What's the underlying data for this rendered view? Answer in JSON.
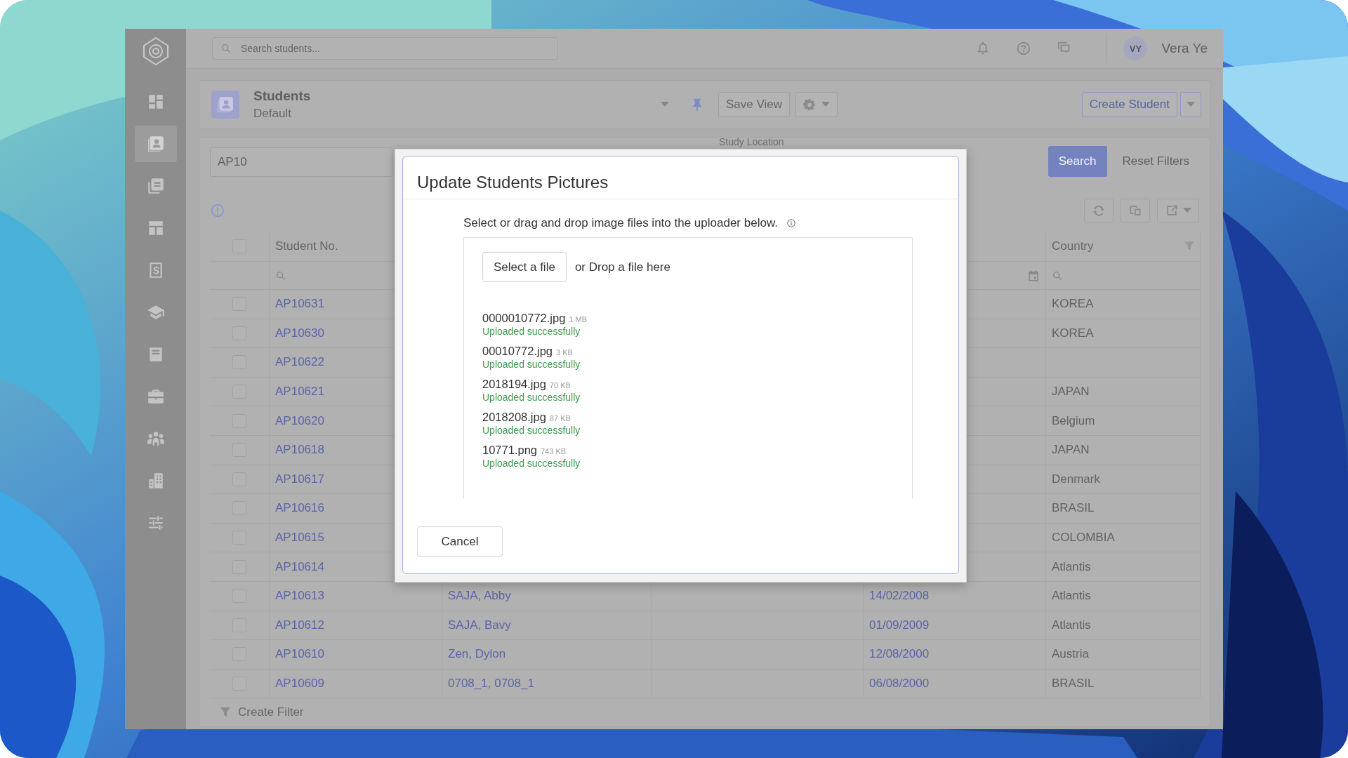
{
  "sidebar": {
    "items": [
      {
        "kind": "grid",
        "selected": false
      },
      {
        "kind": "contact-card",
        "selected": true
      },
      {
        "kind": "copy",
        "selected": false
      },
      {
        "kind": "layout",
        "selected": false
      },
      {
        "kind": "dollar",
        "selected": false
      },
      {
        "kind": "graduation-cap",
        "selected": false
      },
      {
        "kind": "book",
        "selected": false
      },
      {
        "kind": "briefcase",
        "selected": false
      },
      {
        "kind": "people",
        "selected": false
      },
      {
        "kind": "building",
        "selected": false
      },
      {
        "kind": "sliders",
        "selected": false
      }
    ]
  },
  "topbar": {
    "search": {
      "placeholder": "Search students..."
    },
    "user": {
      "initials": "VY",
      "name": "Vera Ye"
    }
  },
  "header": {
    "title": "Students",
    "view": "Default",
    "save_view": "Save View",
    "create": "Create Student"
  },
  "filters": {
    "query": "AP10",
    "study_location_label": "Study Location",
    "search": "Search",
    "reset": "Reset Filters"
  },
  "table": {
    "all_checked": false,
    "student_no_header": "Student No.",
    "country_header": "Country",
    "rows": [
      {
        "checked": false,
        "student_no": "AP10631",
        "country": "KOREA"
      },
      {
        "checked": false,
        "student_no": "AP10630",
        "country": "KOREA"
      },
      {
        "checked": false,
        "student_no": "AP10622"
      },
      {
        "checked": false,
        "student_no": "AP10621",
        "country": "JAPAN"
      },
      {
        "checked": false,
        "student_no": "AP10620",
        "country": "Belgium"
      },
      {
        "checked": false,
        "student_no": "AP10618",
        "country": "JAPAN"
      },
      {
        "checked": false,
        "student_no": "AP10617",
        "country": "Denmark"
      },
      {
        "checked": false,
        "student_no": "AP10616",
        "country": "BRASIL"
      },
      {
        "checked": false,
        "student_no": "AP10615",
        "country": "COLOMBIA"
      },
      {
        "checked": false,
        "student_no": "AP10614",
        "country": "Atlantis"
      },
      {
        "checked": false,
        "student_no": "AP10613",
        "column_3": "SAJA, Abby",
        "column_5": "14/02/2008",
        "country": "Atlantis"
      },
      {
        "checked": false,
        "student_no": "AP10612",
        "column_3": "SAJA, Bavy",
        "column_5": "01/09/2009",
        "country": "Atlantis"
      },
      {
        "checked": false,
        "student_no": "AP10610",
        "column_3": "Zen, Dylon",
        "column_5": "12/08/2000",
        "country": "Austria"
      },
      {
        "checked": false,
        "student_no": "AP10609",
        "column_3": "0708_1, 0708_1",
        "column_5": "06/08/2000",
        "country": "BRASIL"
      }
    ]
  },
  "footer": {
    "create_filter": "Create Filter"
  },
  "dialog": {
    "title": "Update Students Pictures",
    "instruction": "Select or drag and drop image files into the uploader below.",
    "select_button": "Select a file",
    "drop_text": "or Drop a file here",
    "files": [
      {
        "name": "0000010772.jpg",
        "size": "1 MB",
        "status": "Uploaded successfully"
      },
      {
        "name": "00010772.jpg",
        "size": "3 KB",
        "status": "Uploaded successfully"
      },
      {
        "name": "2018194.jpg",
        "size": "70 KB",
        "status": "Uploaded successfully"
      },
      {
        "name": "2018208.jpg",
        "size": "87 KB",
        "status": "Uploaded successfully"
      },
      {
        "name": "10771.png",
        "size": "743 KB",
        "status": "Uploaded successfully"
      }
    ],
    "cancel": "Cancel"
  }
}
